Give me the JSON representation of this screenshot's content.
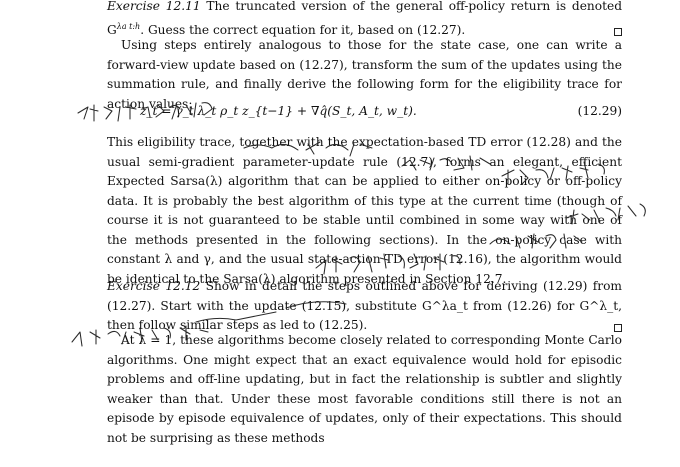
{
  "exercise_12_11": {
    "label": "Exercise 12.11",
    "text": "The truncated version of the general off-policy return is denoted G",
    "symbol": "λa t:h",
    "rest": ". Guess the correct equation for it, based on (12.27)."
  },
  "para_forward_view": "Using steps entirely analogous to those for the state case, one can write a forward-view update based on (12.27), transform the sum of the updates using the summation rule, and finally derive the following form for the eligibility trace for action values:",
  "equation": {
    "body": "z_t = γ_t λ_t ρ_t z_{t−1} + ∇q̂(S_t, A_t, w_t).",
    "number": "(12.29)"
  },
  "para_eligibility": "This eligibility trace, together with the expectation-based TD error (12.28) and the usual semi-gradient parameter-update rule (12.7), forms an elegant, efficient Expected Sarsa(λ) algorithm that can be applied to either on-policy or off-policy data. It is probably the best algorithm of this type at the current time (though of course it is not guaranteed to be stable until combined in some way with one of the methods presented in the following sections). In the on-policy case with constant λ and γ, and the usual state-action TD error (12.16), the algorithm would be identical to the Sarsa(λ) algorithm presented in Section 12.7.",
  "exercise_12_12": {
    "label": "Exercise 12.12",
    "text": "Show in detail the steps outlined above for deriving (12.29) from (12.27). Start with the update (12.15), substitute G^λa_t from (12.26) for G^λ_t, then follow similar steps as led to (12.25)."
  },
  "para_monte_carlo": "At λ = 1, these algorithms become closely related to corresponding Monte Carlo algorithms. One might expect that an exact equivalence would hold for episodic problems and off-line updating, but in fact the relationship is subtler and slightly weaker than that. Under these most favorable conditions still there is not an episode by episode equivalence of updates, only of their expectations. This should not be surprising as these methods",
  "handwritten_notes": {
    "note_1": "我本身难以人，因为我孔自",
    "note_2": "我是我的是和有所以",
    "note_3": "不算有我中在",
    "note_4": "我了我的所不出是",
    "note_5": "我们的事是没有的",
    "note_6": "我们于我的孩子",
    "note_7": "是我的结论，是的",
    "note_8": "那阶出来的我们心"
  }
}
